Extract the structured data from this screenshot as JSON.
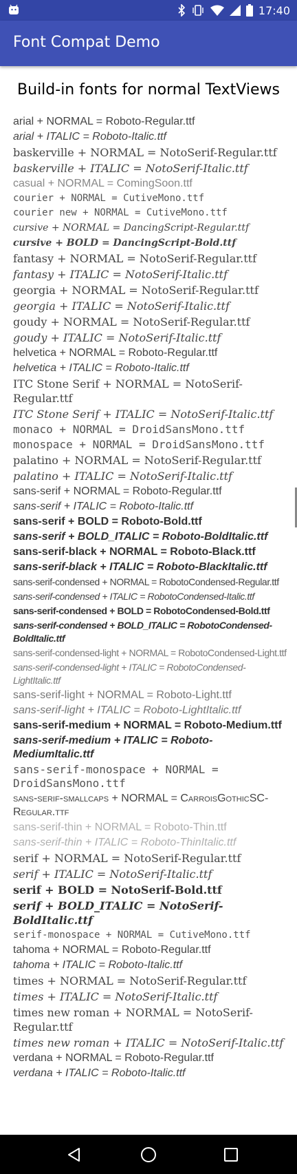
{
  "status_bar": {
    "time": "17:40",
    "icons": [
      "android-icon",
      "bluetooth-icon",
      "vibrate-icon",
      "wifi-icon",
      "signal-icon",
      "battery-icon"
    ]
  },
  "app_bar": {
    "title": "Font Compat Demo"
  },
  "heading": "Build-in fonts for normal TextViews",
  "rows": [
    "arial + NORMAL = Roboto-Regular.ttf",
    "arial + ITALIC = Roboto-Italic.ttf",
    "baskerville + NORMAL = NotoSerif-Regular.ttf",
    "baskerville + ITALIC = NotoSerif-Italic.ttf",
    "casual + NORMAL = ComingSoon.ttf",
    "courier + NORMAL = CutiveMono.ttf",
    "courier new + NORMAL = CutiveMono.ttf",
    "cursive + NORMAL = DancingScript-Regular.ttf",
    "cursive + BOLD = DancingScript-Bold.ttf",
    "fantasy + NORMAL = NotoSerif-Regular.ttf",
    "fantasy + ITALIC = NotoSerif-Italic.ttf",
    "georgia + NORMAL = NotoSerif-Regular.ttf",
    "georgia + ITALIC = NotoSerif-Italic.ttf",
    "goudy + NORMAL = NotoSerif-Regular.ttf",
    "goudy + ITALIC = NotoSerif-Italic.ttf",
    "helvetica + NORMAL = Roboto-Regular.ttf",
    "helvetica + ITALIC = Roboto-Italic.ttf",
    "ITC Stone Serif + NORMAL = NotoSerif-Regular.ttf",
    "ITC Stone Serif + ITALIC = NotoSerif-Italic.ttf",
    "monaco + NORMAL = DroidSansMono.ttf",
    "monospace + NORMAL = DroidSansMono.ttf",
    "palatino + NORMAL = NotoSerif-Regular.ttf",
    "palatino + ITALIC = NotoSerif-Italic.ttf",
    "sans-serif + NORMAL = Roboto-Regular.ttf",
    "sans-serif + ITALIC = Roboto-Italic.ttf",
    "sans-serif + BOLD = Roboto-Bold.ttf",
    "sans-serif + BOLD_ITALIC = Roboto-BoldItalic.ttf",
    "sans-serif-black + NORMAL = Roboto-Black.ttf",
    "sans-serif-black + ITALIC = Roboto-BlackItalic.ttf",
    "sans-serif-condensed + NORMAL = RobotoCondensed-Regular.ttf",
    "sans-serif-condensed + ITALIC = RobotoCondensed-Italic.ttf",
    "sans-serif-condensed + BOLD = RobotoCondensed-Bold.ttf",
    "sans-serif-condensed + BOLD_ITALIC = RobotoCondensed-BoldItalic.ttf",
    "sans-serif-condensed-light + NORMAL = RobotoCondensed-Light.ttf",
    "sans-serif-condensed-light + ITALIC = RobotoCondensed-LightItalic.ttf",
    "sans-serif-light + NORMAL = Roboto-Light.ttf",
    "sans-serif-light + ITALIC = Roboto-LightItalic.ttf",
    "sans-serif-medium + NORMAL = Roboto-Medium.ttf",
    "sans-serif-medium + ITALIC = Roboto-MediumItalic.ttf",
    "sans-serif-monospace + NORMAL = DroidSansMono.ttf",
    "sans-serif-smallcaps + NORMAL = CarroisGothicSC-Regular.ttf",
    "sans-serif-thin + NORMAL = Roboto-Thin.ttf",
    "sans-serif-thin + ITALIC = Roboto-ThinItalic.ttf",
    "serif + NORMAL = NotoSerif-Regular.ttf",
    "serif + ITALIC = NotoSerif-Italic.ttf",
    "serif + BOLD = NotoSerif-Bold.ttf",
    "serif + BOLD_ITALIC = NotoSerif-BoldItalic.ttf",
    "serif-monospace + NORMAL = CutiveMono.ttf",
    "tahoma + NORMAL = Roboto-Regular.ttf",
    "tahoma + ITALIC = Roboto-Italic.ttf",
    "times + NORMAL = NotoSerif-Regular.ttf",
    "times + ITALIC = NotoSerif-Italic.ttf",
    "times new roman + NORMAL = NotoSerif-Regular.ttf",
    "times new roman + ITALIC = NotoSerif-Italic.ttf",
    "verdana + NORMAL = Roboto-Regular.ttf",
    "verdana + ITALIC = Roboto-Italic.ttf"
  ],
  "nav_bar": {
    "buttons": [
      "back-icon",
      "home-icon",
      "recents-icon"
    ]
  },
  "colors": {
    "status_bar": "#3345a6",
    "app_bar": "#3f51b5",
    "nav_bar": "#000000"
  }
}
